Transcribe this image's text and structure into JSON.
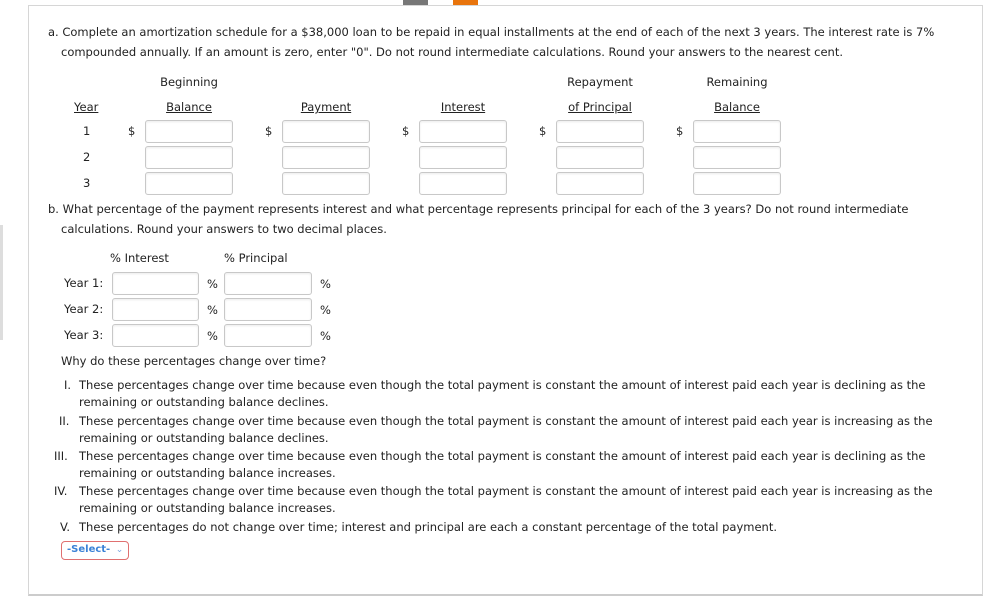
{
  "part_a": {
    "prompt_line1": "a. Complete an amortization schedule for a $38,000 loan to be repaid in equal installments at the end of each of the next 3 years. The interest rate is 7%",
    "prompt_line2": "compounded annually. If an amount is zero, enter \"0\". Do not round intermediate calculations. Round your answers to the nearest cent.",
    "headers": {
      "year": "Year",
      "beginning_top": "Beginning",
      "beginning": "Balance",
      "payment": "Payment",
      "interest": "Interest",
      "repayment_top": "Repayment",
      "repayment": "of Principal",
      "remaining_top": "Remaining",
      "remaining": "Balance"
    },
    "currency": "$",
    "years": [
      "1",
      "2",
      "3"
    ]
  },
  "part_b": {
    "prompt_line1": "b. What percentage of the payment represents interest and what percentage represents principal for each of the 3 years? Do not round intermediate",
    "prompt_line2": "calculations. Round your answers to two decimal places.",
    "col_interest": "% Interest",
    "col_principal": "% Principal",
    "percent": "%",
    "rows": [
      "Year 1:",
      "Year 2:",
      "Year 3:"
    ],
    "question": "Why do these percentages change over time?",
    "options": [
      {
        "num": "I.",
        "l1": "These percentages change over time because even though the total payment is constant the amount of interest paid each year is declining as the",
        "l2": "remaining or outstanding balance declines."
      },
      {
        "num": "II.",
        "l1": "These percentages change over time because even though the total payment is constant the amount of interest paid each year is increasing as the",
        "l2": "remaining or outstanding balance declines."
      },
      {
        "num": "III.",
        "l1": "These percentages change over time because even though the total payment is constant the amount of interest paid each year is declining as the",
        "l2": "remaining or outstanding balance increases."
      },
      {
        "num": "IV.",
        "l1": "These percentages change over time because even though the total payment is constant the amount of interest paid each year is increasing as the",
        "l2": "remaining or outstanding balance increases."
      },
      {
        "num": "V.",
        "l1": "These percentages do not change over time; interest and principal are each a constant percentage of the total payment.",
        "l2": ""
      }
    ],
    "select": "-Select-"
  }
}
